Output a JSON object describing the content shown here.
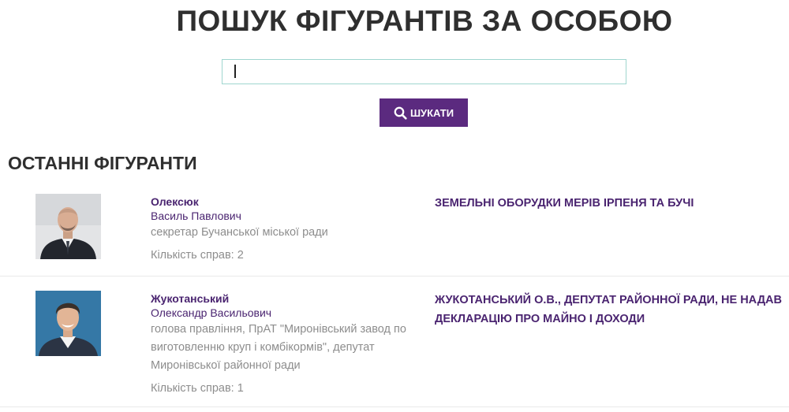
{
  "header": {
    "title": "ПОШУК ФІГУРАНТІВ ЗА ОСОБОЮ"
  },
  "search": {
    "value": "",
    "button_label": "ШУКАТИ",
    "button_icon": "search-icon",
    "accent_color": "#5b2a7f"
  },
  "recent": {
    "title": "ОСТАННІ ФІГУРАНТИ",
    "items": [
      {
        "surname": "Олексюк",
        "given_names": "Василь Павлович",
        "position": "секретар Бучанської міської ради",
        "count_label": "Кількість справ: 2",
        "case_title": "ЗЕМЕЛЬНІ ОБОРУДКИ МЕРІВ ІРПЕНЯ ТА БУЧІ"
      },
      {
        "surname": "Жукотанський",
        "given_names": "Олександр Васильович",
        "position": "голова правління, ПрАТ \"Миронівський завод по виготовленню круп і комбікормів\", депутат Миронівської районної ради",
        "count_label": "Кількість справ: 1",
        "case_title": "ЖУКОТАНСЬКИЙ О.В., ДЕПУТАТ РАЙОННОЇ РАДИ, НЕ НАДАВ ДЕКЛАРАЦІЮ ПРО МАЙНО І ДОХОДИ"
      }
    ]
  }
}
